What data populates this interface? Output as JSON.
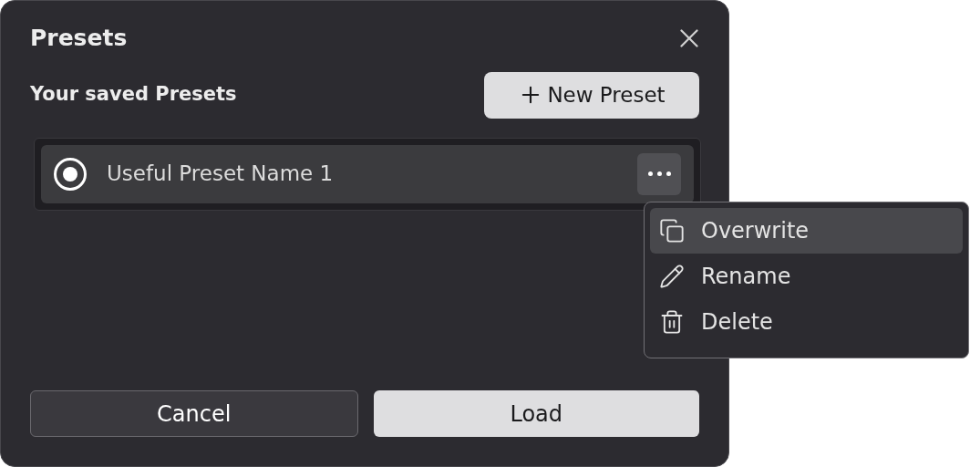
{
  "dialog": {
    "title": "Presets",
    "section_label": "Your saved Presets",
    "new_button": "New Preset"
  },
  "presets": [
    {
      "name": "Useful Preset Name 1",
      "selected": true
    }
  ],
  "context_menu": {
    "items": [
      {
        "label": "Overwrite",
        "kind": "overwrite",
        "selected": true
      },
      {
        "label": "Rename",
        "kind": "rename",
        "selected": false
      },
      {
        "label": "Delete",
        "kind": "delete",
        "selected": false
      }
    ]
  },
  "buttons": [
    {
      "label": "Cancel",
      "kind": "secondary"
    },
    {
      "label": "Load",
      "kind": "primary"
    }
  ]
}
